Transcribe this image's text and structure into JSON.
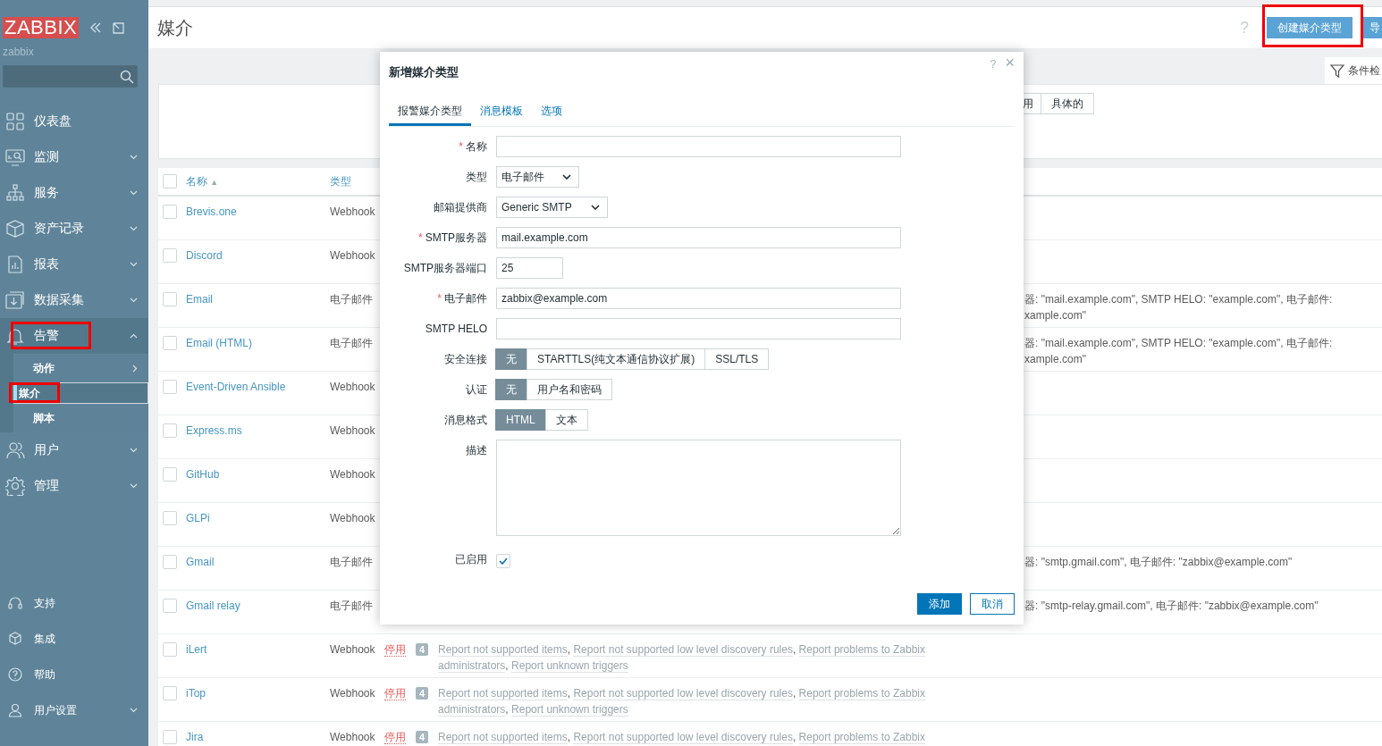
{
  "sidebar": {
    "logo": "ZABBIX",
    "server_name": "zabbix",
    "menu": [
      {
        "label": "仪表盘"
      },
      {
        "label": "监测",
        "expanded": false
      },
      {
        "label": "服务",
        "expanded": false
      },
      {
        "label": "资产记录",
        "expanded": false
      },
      {
        "label": "报表",
        "expanded": false
      },
      {
        "label": "数据采集",
        "expanded": false
      },
      {
        "label": "告警",
        "expanded": true,
        "highlighted": true,
        "children": [
          {
            "label": "动作",
            "has_submenu": true,
            "selected": false
          },
          {
            "label": "媒介",
            "selected": true,
            "highlighted": true
          },
          {
            "label": "脚本",
            "selected": false
          }
        ]
      },
      {
        "label": "用户",
        "expanded": false
      },
      {
        "label": "管理",
        "expanded": false
      }
    ],
    "bottom_menu": [
      {
        "label": "支持"
      },
      {
        "label": "集成"
      },
      {
        "label": "帮助"
      },
      {
        "label": "用户设置",
        "expanded": false
      }
    ]
  },
  "page": {
    "title": "媒介",
    "help": "?",
    "create_button": {
      "label": "创建媒介类型",
      "highlighted": true
    },
    "import_button": "导",
    "filter_tab": "条件检"
  },
  "filter": {
    "status_options": [
      {
        "label": "用",
        "selected": false
      },
      {
        "label": "具体的",
        "selected": false
      }
    ]
  },
  "table": {
    "select_all_checked": false,
    "columns": [
      {
        "label": "名称",
        "sort": "▲"
      },
      {
        "label": "类型"
      }
    ],
    "action_separator": ",",
    "rows": [
      {
        "checked": false,
        "name": "Brevis.one",
        "type": "Webhook"
      },
      {
        "checked": false,
        "name": "Discord",
        "type": "Webhook"
      },
      {
        "checked": false,
        "name": "Email",
        "type": "电子邮件",
        "details": [
          "器: \"mail.example.com\", SMTP HELO: \"example.com\", 电子邮件:",
          "xample.com\""
        ]
      },
      {
        "checked": false,
        "name": "Email (HTML)",
        "type": "电子邮件",
        "details": [
          "器: \"mail.example.com\", SMTP HELO: \"example.com\", 电子邮件:",
          "xample.com\""
        ]
      },
      {
        "checked": false,
        "name": "Event-Driven Ansible",
        "type": "Webhook"
      },
      {
        "checked": false,
        "name": "Express.ms",
        "type": "Webhook"
      },
      {
        "checked": false,
        "name": "GitHub",
        "type": "Webhook"
      },
      {
        "checked": false,
        "name": "GLPi",
        "type": "Webhook"
      },
      {
        "checked": false,
        "name": "Gmail",
        "type": "电子邮件",
        "details": [
          "器: \"smtp.gmail.com\", 电子邮件: \"zabbix@example.com\""
        ]
      },
      {
        "checked": false,
        "name": "Gmail relay",
        "type": "电子邮件",
        "details": [
          "器: \"smtp-relay.gmail.com\", 电子邮件: \"zabbix@example.com\""
        ]
      },
      {
        "checked": false,
        "name": "iLert",
        "type": "Webhook",
        "status": "停用",
        "enabled": false,
        "action_count": "4",
        "actions": [
          {
            "text": "Report not supported items",
            "comma": true
          },
          {
            "text": "Report not supported low level discovery rules",
            "comma": true
          },
          {
            "text": "Report problems to Zabbix",
            "comma": false
          },
          {
            "text": "administrators",
            "comma": true
          },
          {
            "text": "Report unknown triggers",
            "comma": false
          }
        ]
      },
      {
        "checked": false,
        "name": "iTop",
        "type": "Webhook",
        "status": "停用",
        "enabled": false,
        "action_count": "4",
        "actions": [
          {
            "text": "Report not supported items",
            "comma": true
          },
          {
            "text": "Report not supported low level discovery rules",
            "comma": true
          },
          {
            "text": "Report problems to Zabbix",
            "comma": false
          },
          {
            "text": "administrators",
            "comma": true
          },
          {
            "text": "Report unknown triggers",
            "comma": false
          }
        ]
      },
      {
        "checked": false,
        "name": "Jira",
        "type": "Webhook",
        "status": "停用",
        "enabled": false,
        "action_count": "4",
        "actions": [
          {
            "text": "Report not supported items",
            "comma": true
          },
          {
            "text": "Report not supported low level discovery rules",
            "comma": true
          },
          {
            "text": "Report problems to Zabbix",
            "comma": false
          }
        ]
      }
    ]
  },
  "dialog": {
    "title": "新增媒介类型",
    "help": "?",
    "close": "×",
    "required_mark": "*",
    "tabs": [
      {
        "label": "报警媒介类型",
        "selected": true
      },
      {
        "label": "消息模板",
        "selected": false
      },
      {
        "label": "选项",
        "selected": false
      }
    ],
    "fields": [
      {
        "kind": "text",
        "label": "名称",
        "required": true
      },
      {
        "kind": "select",
        "label": "类型",
        "value": "电子邮件"
      },
      {
        "kind": "select",
        "label": "邮箱提供商",
        "value": "Generic SMTP"
      },
      {
        "kind": "text",
        "label": "SMTP服务器",
        "required": true,
        "value": "mail.example.com"
      },
      {
        "kind": "text",
        "label": "SMTP服务器端口",
        "value": "25"
      },
      {
        "kind": "text",
        "label": "电子邮件",
        "required": true,
        "value": "zabbix@example.com"
      },
      {
        "kind": "text",
        "label": "SMTP HELO"
      },
      {
        "kind": "segmented",
        "label": "安全连接",
        "options": [
          {
            "label": "无",
            "selected": true
          },
          {
            "label": "STARTTLS(纯文本通信协议扩展)",
            "selected": false
          },
          {
            "label": "SSL/TLS",
            "selected": false
          }
        ]
      },
      {
        "kind": "segmented",
        "label": "认证",
        "options": [
          {
            "label": "无",
            "selected": true
          },
          {
            "label": "用户名和密码",
            "selected": false
          }
        ]
      },
      {
        "kind": "segmented",
        "label": "消息格式",
        "options": [
          {
            "label": "HTML",
            "selected": true
          },
          {
            "label": "文本",
            "selected": false
          }
        ]
      },
      {
        "kind": "textarea",
        "label": "描述"
      },
      {
        "kind": "checkbox",
        "label": "已启用",
        "checked": true
      }
    ],
    "buttons": [
      {
        "label": "添加",
        "kind": "primary"
      },
      {
        "label": "取消",
        "kind": "secondary"
      }
    ]
  }
}
